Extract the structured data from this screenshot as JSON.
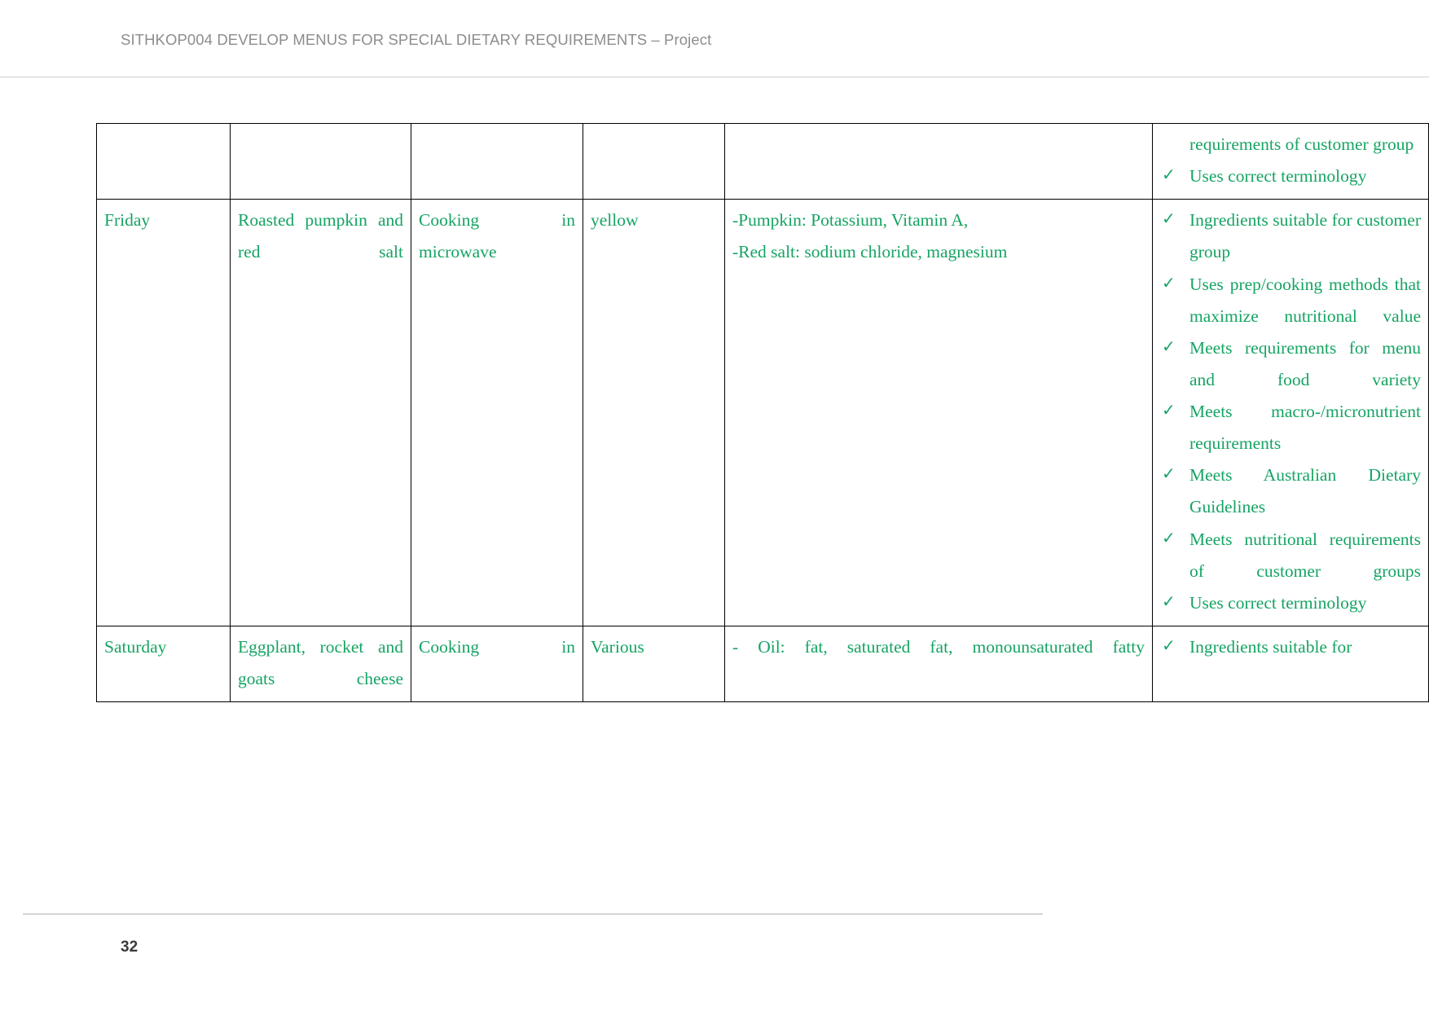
{
  "header": {
    "title": "SITHKOP004 DEVELOP MENUS FOR SPECIAL DIETARY REQUIREMENTS – Project"
  },
  "footer": {
    "page_number": "32"
  },
  "colors": {
    "text_green": "#16a463",
    "header_grey": "#8d8d8d",
    "border": "#000000"
  },
  "icons": {
    "tick": "✓"
  },
  "table": {
    "rows": [
      {
        "day": "",
        "dish": "",
        "method": "",
        "colour": "",
        "nutrition": [],
        "checklist": [
          "requirements of customer group",
          "Uses correct terminology"
        ],
        "continuation": true
      },
      {
        "day": "Friday",
        "dish": "Roasted pumpkin and red salt",
        "method": "Cooking in microwave",
        "colour": "yellow",
        "nutrition": [
          "-Pumpkin: Potassium, Vitamin A,",
          "-Red salt: sodium chloride, magnesium"
        ],
        "checklist": [
          "Ingredients suitable for customer group",
          "Uses prep/cooking methods that maximize nutritional value",
          "Meets requirements for menu and food variety",
          "Meets macro-/micronutrient requirements",
          "Meets Australian Dietary Guidelines",
          "Meets nutritional requirements of customer groups",
          "Uses correct terminology"
        ],
        "continuation": false
      },
      {
        "day": "Saturday",
        "dish": "Eggplant, rocket and goats cheese",
        "method": "Cooking in",
        "colour": "Various",
        "nutrition": [
          "- Oil: fat, saturated fat, monounsaturated fatty"
        ],
        "checklist": [
          "Ingredients suitable for"
        ],
        "continuation": false
      }
    ]
  }
}
